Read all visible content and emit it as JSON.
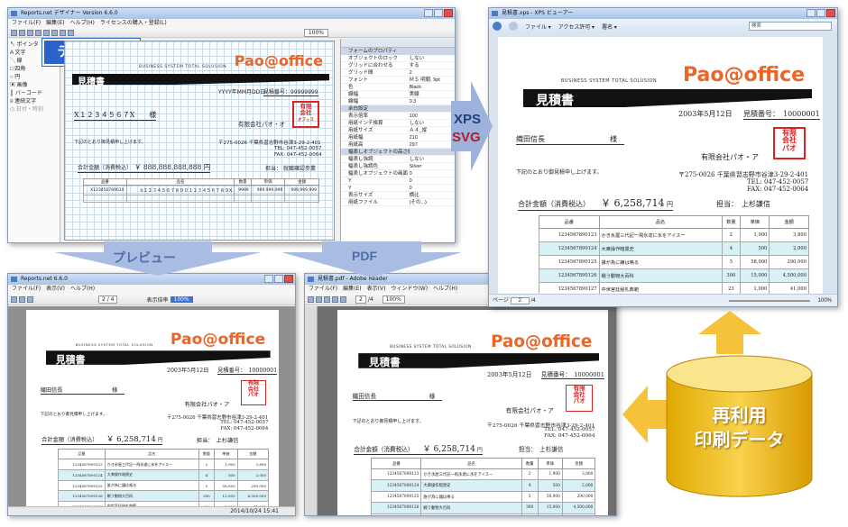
{
  "brand": {
    "tagline": "BUSINESS SYSTEM TOTAL SOLUSION",
    "logo": "Pao@office"
  },
  "stamp_lines": [
    "有限",
    "会社",
    "オフィス",
    "パオ"
  ],
  "designer": {
    "title": "Reports.net デザイナー Version 6.6.0",
    "menu": [
      "ファイル(F)",
      "編集(E)",
      "ヘルプ(H)",
      "ライセンスの購入・登録(L)"
    ],
    "zoom": "100%",
    "banner": "デザイン時",
    "tools": [
      "ポインタ",
      "文字",
      "線",
      "四角",
      "円",
      "画像",
      "バーコード",
      "連続文字",
      "日付・時刻"
    ],
    "doc": {
      "heading": "見積書",
      "date": "YYYY年MM月DD日",
      "number_label": "見積番号：",
      "number": "99999999",
      "customer": "X１２３４５６７X",
      "honorific": "様",
      "company": "有限会社パオ・オ",
      "greeting": "下記のとおり御見積申し上げます。",
      "address": "〒275-0026 千葉県習志野市谷津3-29-2-401",
      "tel": "TEL: 047-452-0057",
      "fax": "FAX: 047-452-0064",
      "total_label": "合計金額（消費税込）",
      "total": "￥ 888,888,888,888 円",
      "person_label": "担当：",
      "person": "就職確認参業",
      "headers": [
        "品番",
        "品名",
        "数量",
        "単価",
        "金額"
      ],
      "row": [
        "X12345678901X",
        "X１２３４５６７８９０１２３４５６７８９X",
        "9999",
        "999,999,999",
        "999,999,999"
      ]
    },
    "props": {
      "title": "フォームのプロパティ",
      "rows": [
        [
          "オブジェクトのロック",
          "しない"
        ],
        [
          "グリッドに合わせる",
          "する"
        ],
        [
          "グリッド間",
          "2"
        ],
        [
          "フォント",
          "ＭＳ 明朝, 9pt"
        ],
        [
          "色",
          "Black"
        ],
        [
          "線幅",
          "実線"
        ],
        [
          "線幅",
          "0.3"
        ],
        [
          "余白設定",
          ""
        ],
        [
          "表示倍率",
          "100"
        ],
        [
          "用紙インチ換算",
          "しない"
        ],
        [
          "用紙サイズ",
          "Ａ４_縦"
        ],
        [
          "用紙幅",
          "210"
        ],
        [
          "用紙高",
          "297"
        ],
        [
          "幅表しオブジェクトの高さ編集",
          ""
        ],
        [
          "幅表し強調",
          "しない"
        ],
        [
          "幅表し強調色",
          "Silver"
        ],
        [
          "幅表しオブジェクトの画面",
          "0"
        ],
        [
          "Y",
          "0"
        ],
        [
          "Y",
          "0"
        ],
        [
          "表示サイズ",
          "横比"
        ],
        [
          "用紙ファイル",
          "(その...)"
        ]
      ]
    }
  },
  "labels": {
    "xps": "XPS",
    "svg": "SVG",
    "preview": "プレビュー",
    "pdf": "PDF",
    "reuse_line1": "再利用",
    "reuse_line2": "印刷データ"
  },
  "estimate": {
    "heading": "見積書",
    "date": "2003年5月12日",
    "number_label": "見積番号：",
    "number": "10000001",
    "customer": "織田信長",
    "honorific": "様",
    "company": "有限会社パオ・ア",
    "greeting": "下記のとおり御見積申し上げます。",
    "address": "〒275-0026 千葉県習志野市谷津3-29-2-401",
    "tel": "TEL: 047-452-0057",
    "fax": "FAX: 047-452-0064",
    "total_label": "合計金額（消費税込）",
    "total": "￥ 6,258,714",
    "yen": "円",
    "person_label": "担当：",
    "person": "上杉謙信",
    "headers": [
      "品番",
      "品名",
      "数量",
      "単価",
      "金額"
    ],
    "rows": [
      [
        "1234567890123",
        "かき氷屋三代記一飛氷達に氷をアイスー",
        "2",
        "1,900",
        "3,800"
      ],
      [
        "1234567890124",
        "大衆操作暗黒史",
        "4",
        "500",
        "2,000"
      ],
      [
        "1234567890125",
        "誰が為に鐘は鳴る",
        "5",
        "58,000",
        "290,000"
      ],
      [
        "1234567890126",
        "戦う動物大百科",
        "300",
        "15,000",
        "4,500,000"
      ],
      [
        "1234567890127",
        "中世宮廷秘札典範",
        "23",
        "1,000",
        "41,000"
      ],
      [
        "1234567890128",
        "",
        "40",
        "1,300",
        "52,000"
      ]
    ]
  },
  "xps_viewer": {
    "title": "見積書.xps - XPS ビューアー",
    "menu": [
      "ファイル ▾",
      "アクセス許可 ▾",
      "署名 ▾"
    ],
    "search_placeholder": "検索",
    "page": "2",
    "pages": "/4",
    "zoom": "100%"
  },
  "preview_win": {
    "title": "Reports.net 6.6.0",
    "menu": [
      "ファイル(F)",
      "表示(V)",
      "ヘルプ(H)"
    ],
    "page": "2 / 4",
    "zoom_label": "表示倍率",
    "zoom": "100%",
    "status": "2014/10/24 15:41"
  },
  "pdf_win": {
    "title": "見積書.pdf - Adobe Reader",
    "menu": [
      "ファイル(F)",
      "編集(E)",
      "表示(V)",
      "ウィンドウ(W)",
      "ヘルプ(H)"
    ],
    "page": "2",
    "pages": "/4",
    "zoom": "100%"
  }
}
